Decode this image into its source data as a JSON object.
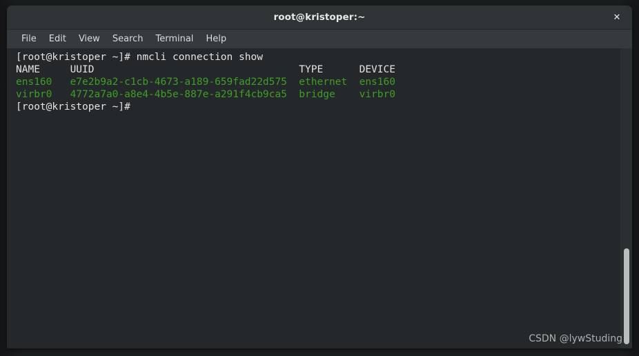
{
  "window": {
    "title": "root@kristoper:~",
    "close_icon": "✕",
    "accent_green": "#3f9e26",
    "terminal_bg": "#24282b",
    "titlebar_bg": "#2e3436",
    "menubar_bg": "#343a3d"
  },
  "menu": {
    "items": [
      {
        "label": "File"
      },
      {
        "label": "Edit"
      },
      {
        "label": "View"
      },
      {
        "label": "Search"
      },
      {
        "label": "Terminal"
      },
      {
        "label": "Help"
      }
    ]
  },
  "terminal": {
    "prompt": "[root@kristoper ~]#",
    "command": "nmcli connection show",
    "lines": [
      {
        "text": "[root@kristoper ~]# nmcli connection show",
        "color": "white"
      },
      {
        "text": "NAME     UUID                                  TYPE      DEVICE",
        "color": "white"
      },
      {
        "text": "ens160   e7e2b9a2-c1cb-4673-a189-659fad22d575  ethernet  ens160",
        "color": "green"
      },
      {
        "text": "virbr0   4772a7a0-a8e4-4b5e-887e-a291f4cb9ca5  bridge    virbr0",
        "color": "green"
      },
      {
        "text": "[root@kristoper ~]#",
        "color": "white"
      }
    ],
    "table": {
      "headers": [
        "NAME",
        "UUID",
        "TYPE",
        "DEVICE"
      ],
      "rows": [
        {
          "NAME": "ens160",
          "UUID": "e7e2b9a2-c1cb-4673-a189-659fad22d575",
          "TYPE": "ethernet",
          "DEVICE": "ens160"
        },
        {
          "NAME": "virbr0",
          "UUID": "4772a7a0-a8e4-4b5e-887e-a291f4cb9ca5",
          "TYPE": "bridge",
          "DEVICE": "virbr0"
        }
      ]
    }
  },
  "watermark": {
    "text": "CSDN @lywStuding"
  }
}
